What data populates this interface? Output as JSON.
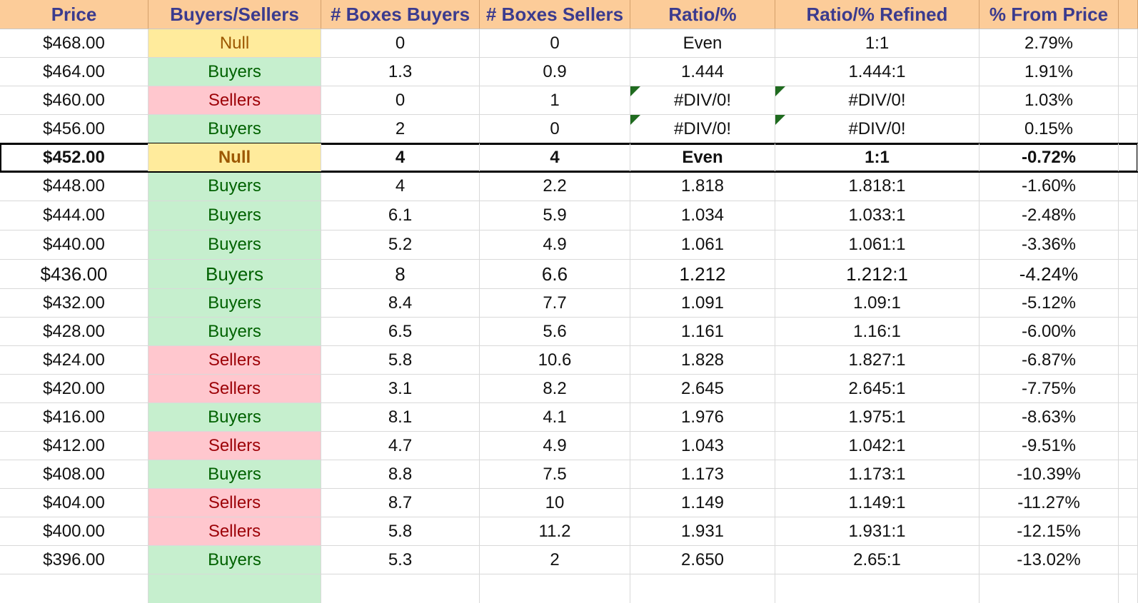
{
  "headers": {
    "price": "Price",
    "side": "Buyers/Sellers",
    "boxes_buyers": "# Boxes Buyers",
    "boxes_sellers": "# Boxes Sellers",
    "ratio": "Ratio/%",
    "ratio_refined": "Ratio/% Refined",
    "from_price": "% From Price"
  },
  "rows": [
    {
      "price": "$468.00",
      "side": "Null",
      "bb": "0",
      "bs": "0",
      "ratio": "Even",
      "refined": "1:1",
      "pct": "2.79%"
    },
    {
      "price": "$464.00",
      "side": "Buyers",
      "bb": "1.3",
      "bs": "0.9",
      "ratio": "1.444",
      "refined": "1.444:1",
      "pct": "1.91%"
    },
    {
      "price": "$460.00",
      "side": "Sellers",
      "bb": "0",
      "bs": "1",
      "ratio": "#DIV/0!",
      "refined": "#DIV/0!",
      "pct": "1.03%"
    },
    {
      "price": "$456.00",
      "side": "Buyers",
      "bb": "2",
      "bs": "0",
      "ratio": "#DIV/0!",
      "refined": "#DIV/0!",
      "pct": "0.15%"
    },
    {
      "price": "$452.00",
      "side": "Null",
      "bb": "4",
      "bs": "4",
      "ratio": "Even",
      "refined": "1:1",
      "pct": "-0.72%"
    },
    {
      "price": "$448.00",
      "side": "Buyers",
      "bb": "4",
      "bs": "2.2",
      "ratio": "1.818",
      "refined": "1.818:1",
      "pct": "-1.60%"
    },
    {
      "price": "$444.00",
      "side": "Buyers",
      "bb": "6.1",
      "bs": "5.9",
      "ratio": "1.034",
      "refined": "1.033:1",
      "pct": "-2.48%"
    },
    {
      "price": "$440.00",
      "side": "Buyers",
      "bb": "5.2",
      "bs": "4.9",
      "ratio": "1.061",
      "refined": "1.061:1",
      "pct": "-3.36%"
    },
    {
      "price": "$436.00",
      "side": "Buyers",
      "bb": "8",
      "bs": "6.6",
      "ratio": "1.212",
      "refined": "1.212:1",
      "pct": "-4.24%"
    },
    {
      "price": "$432.00",
      "side": "Buyers",
      "bb": "8.4",
      "bs": "7.7",
      "ratio": "1.091",
      "refined": "1.09:1",
      "pct": "-5.12%"
    },
    {
      "price": "$428.00",
      "side": "Buyers",
      "bb": "6.5",
      "bs": "5.6",
      "ratio": "1.161",
      "refined": "1.16:1",
      "pct": "-6.00%"
    },
    {
      "price": "$424.00",
      "side": "Sellers",
      "bb": "5.8",
      "bs": "10.6",
      "ratio": "1.828",
      "refined": "1.827:1",
      "pct": "-6.87%"
    },
    {
      "price": "$420.00",
      "side": "Sellers",
      "bb": "3.1",
      "bs": "8.2",
      "ratio": "2.645",
      "refined": "2.645:1",
      "pct": "-7.75%"
    },
    {
      "price": "$416.00",
      "side": "Buyers",
      "bb": "8.1",
      "bs": "4.1",
      "ratio": "1.976",
      "refined": "1.975:1",
      "pct": "-8.63%"
    },
    {
      "price": "$412.00",
      "side": "Sellers",
      "bb": "4.7",
      "bs": "4.9",
      "ratio": "1.043",
      "refined": "1.042:1",
      "pct": "-9.51%"
    },
    {
      "price": "$408.00",
      "side": "Buyers",
      "bb": "8.8",
      "bs": "7.5",
      "ratio": "1.173",
      "refined": "1.173:1",
      "pct": "-10.39%"
    },
    {
      "price": "$404.00",
      "side": "Sellers",
      "bb": "8.7",
      "bs": "10",
      "ratio": "1.149",
      "refined": "1.149:1",
      "pct": "-11.27%"
    },
    {
      "price": "$400.00",
      "side": "Sellers",
      "bb": "5.8",
      "bs": "11.2",
      "ratio": "1.931",
      "refined": "1.931:1",
      "pct": "-12.15%"
    },
    {
      "price": "$396.00",
      "side": "Buyers",
      "bb": "5.3",
      "bs": "2",
      "ratio": "2.650",
      "refined": "2.65:1",
      "pct": "-13.02%"
    }
  ],
  "colors": {
    "header_bg": "#fccc99",
    "header_text": "#3b3b8e",
    "buyers_bg": "#c6efce",
    "buyers_text": "#006100",
    "sellers_bg": "#ffc7ce",
    "sellers_text": "#9c0006",
    "null_bg": "#ffeb9c",
    "null_text": "#9c5700",
    "error_indicator": "#1f6b1f"
  }
}
